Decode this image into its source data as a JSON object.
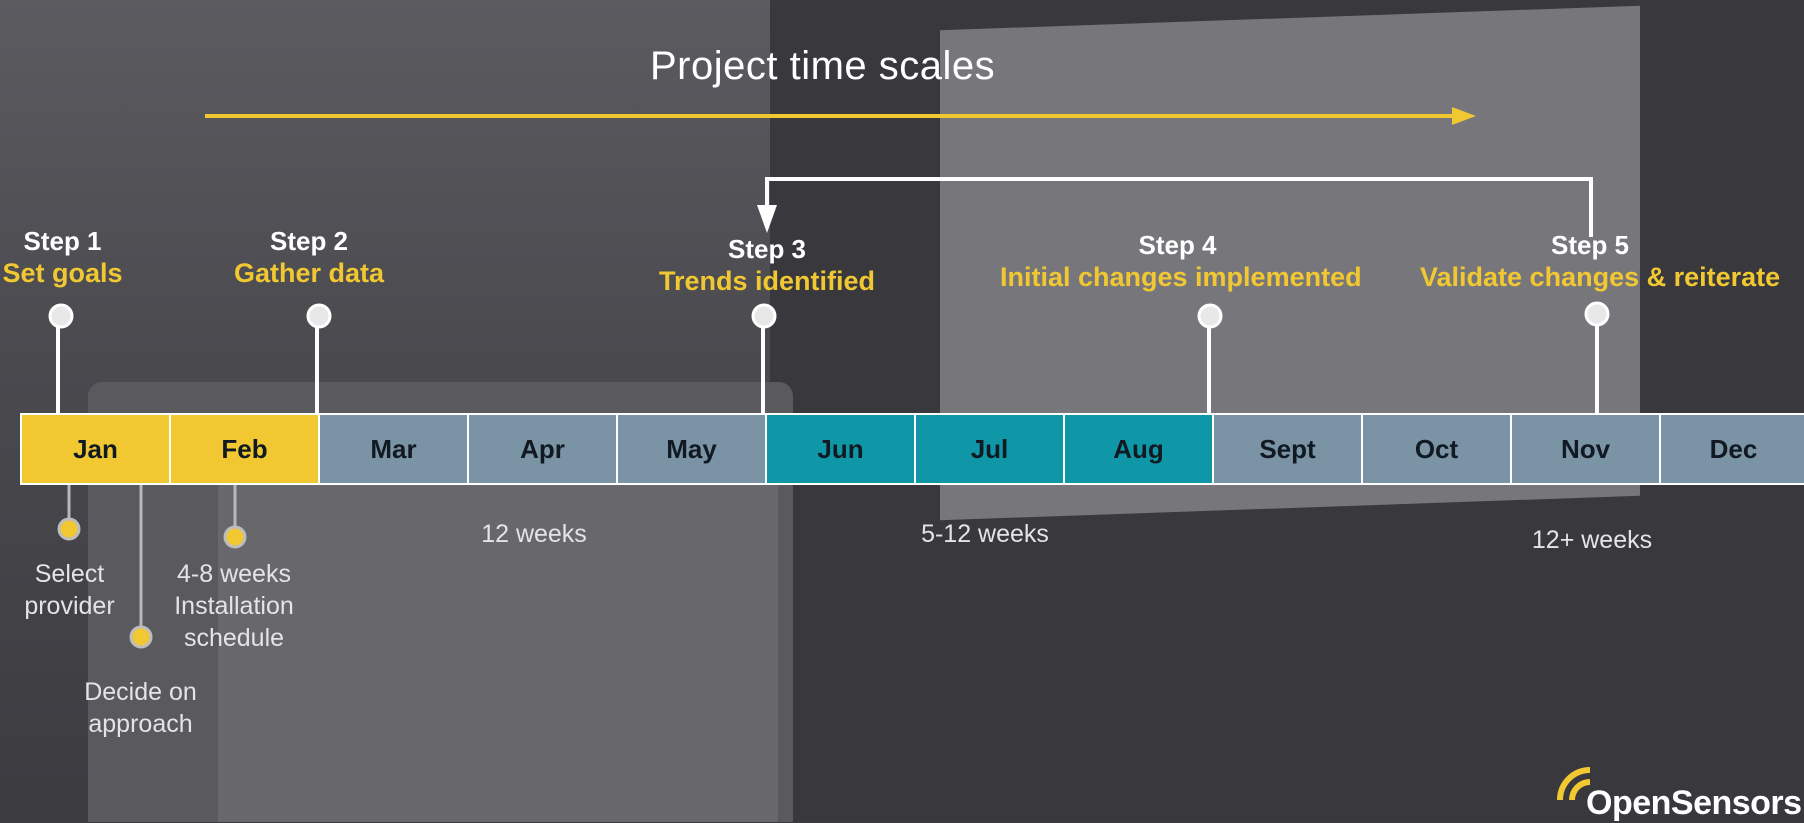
{
  "title": "Project time scales",
  "months": [
    {
      "label": "Jan",
      "color": "#f2c832"
    },
    {
      "label": "Feb",
      "color": "#f2c832"
    },
    {
      "label": "Mar",
      "color": "#7a93a5"
    },
    {
      "label": "Apr",
      "color": "#7a93a5"
    },
    {
      "label": "May",
      "color": "#7a93a5"
    },
    {
      "label": "Jun",
      "color": "#0f97a8"
    },
    {
      "label": "Jul",
      "color": "#0f97a8"
    },
    {
      "label": "Aug",
      "color": "#0f97a8"
    },
    {
      "label": "Sept",
      "color": "#7a93a5"
    },
    {
      "label": "Oct",
      "color": "#7a93a5"
    },
    {
      "label": "Nov",
      "color": "#7a93a5"
    },
    {
      "label": "Dec",
      "color": "#7a93a5"
    }
  ],
  "steps": [
    {
      "title": "Step 1",
      "subtitle": "Set goals"
    },
    {
      "title": "Step 2",
      "subtitle": "Gather data"
    },
    {
      "title": "Step 3",
      "subtitle": "Trends identified"
    },
    {
      "title": "Step 4",
      "subtitle": "Initial changes implemented"
    },
    {
      "title": "Step 5",
      "subtitle": "Validate changes & reiterate"
    }
  ],
  "notes": {
    "select_provider": "Select provider",
    "installation": "4-8 weeks Installation schedule",
    "decide": "Decide on approach"
  },
  "durations": [
    "12 weeks",
    "5-12 weeks",
    "12+ weeks"
  ],
  "logo": "OpenSensors",
  "colors": {
    "accent": "#f2c832",
    "teal": "#0f97a8",
    "slate": "#7a93a5"
  }
}
